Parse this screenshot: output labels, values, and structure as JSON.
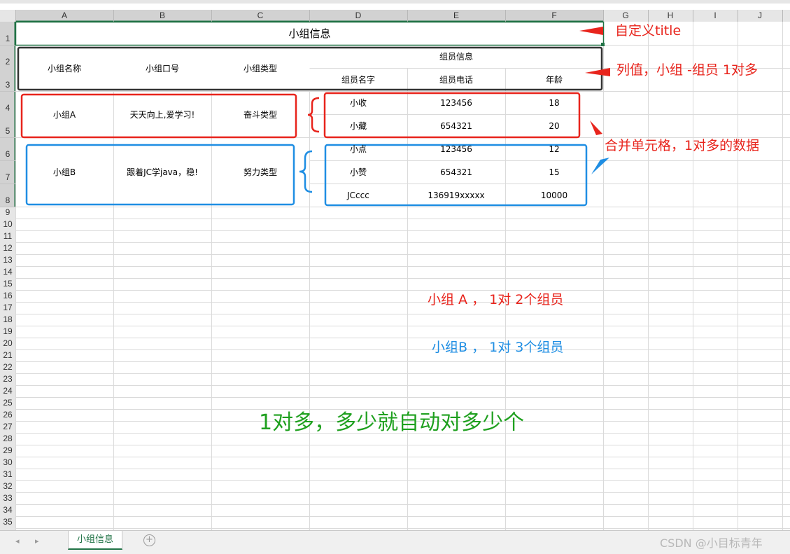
{
  "column_headers": [
    "A",
    "B",
    "C",
    "D",
    "E",
    "F",
    "G",
    "H",
    "I",
    "J"
  ],
  "row_headers": [
    "1",
    "2",
    "3",
    "4",
    "5",
    "6",
    "7",
    "8",
    "9",
    "10",
    "11",
    "12",
    "13",
    "14",
    "15",
    "16",
    "17",
    "18",
    "19",
    "20",
    "21",
    "22",
    "23",
    "24",
    "25",
    "26",
    "27",
    "28",
    "29",
    "30",
    "31",
    "32",
    "33",
    "34",
    "35"
  ],
  "sheet": {
    "title": "小组信息",
    "headers": {
      "group_name": "小组名称",
      "group_slogan": "小组口号",
      "group_type": "小组类型",
      "member_info": "组员信息",
      "member_name": "组员名字",
      "member_phone": "组员电话",
      "member_age": "年龄"
    },
    "groups": [
      {
        "name": "小组A",
        "slogan": "天天向上,爱学习!",
        "type": "奋斗类型",
        "members": [
          {
            "name": "小收",
            "phone": "123456",
            "age": "18"
          },
          {
            "name": "小藏",
            "phone": "654321",
            "age": "20"
          }
        ]
      },
      {
        "name": "小组B",
        "slogan": "跟着JC学java，稳!",
        "type": "努力类型",
        "members": [
          {
            "name": "小点",
            "phone": "123456",
            "age": "12"
          },
          {
            "name": "小赞",
            "phone": "654321",
            "age": "15"
          },
          {
            "name": "JCccc",
            "phone": "136919xxxxx",
            "age": "10000"
          }
        ]
      }
    ]
  },
  "annotations": {
    "custom_title": "自定义title",
    "column_values": "列值，小组 -组员 1对多",
    "merged_cells": "合并单元格，1对多的数据",
    "group_a_note": "小组 A ， 1对 2个组员",
    "group_b_note": "小组B ， 1对 3个组员",
    "summary": "1对多，多少就自动对多少个"
  },
  "footer": {
    "sheet_tab": "小组信息",
    "add_sheet": "+",
    "watermark": "CSDN @小目标青年"
  },
  "colors": {
    "red": "#e8241c",
    "blue": "#1f8ee3",
    "green": "#1fa01f",
    "excel_green": "#217346"
  }
}
